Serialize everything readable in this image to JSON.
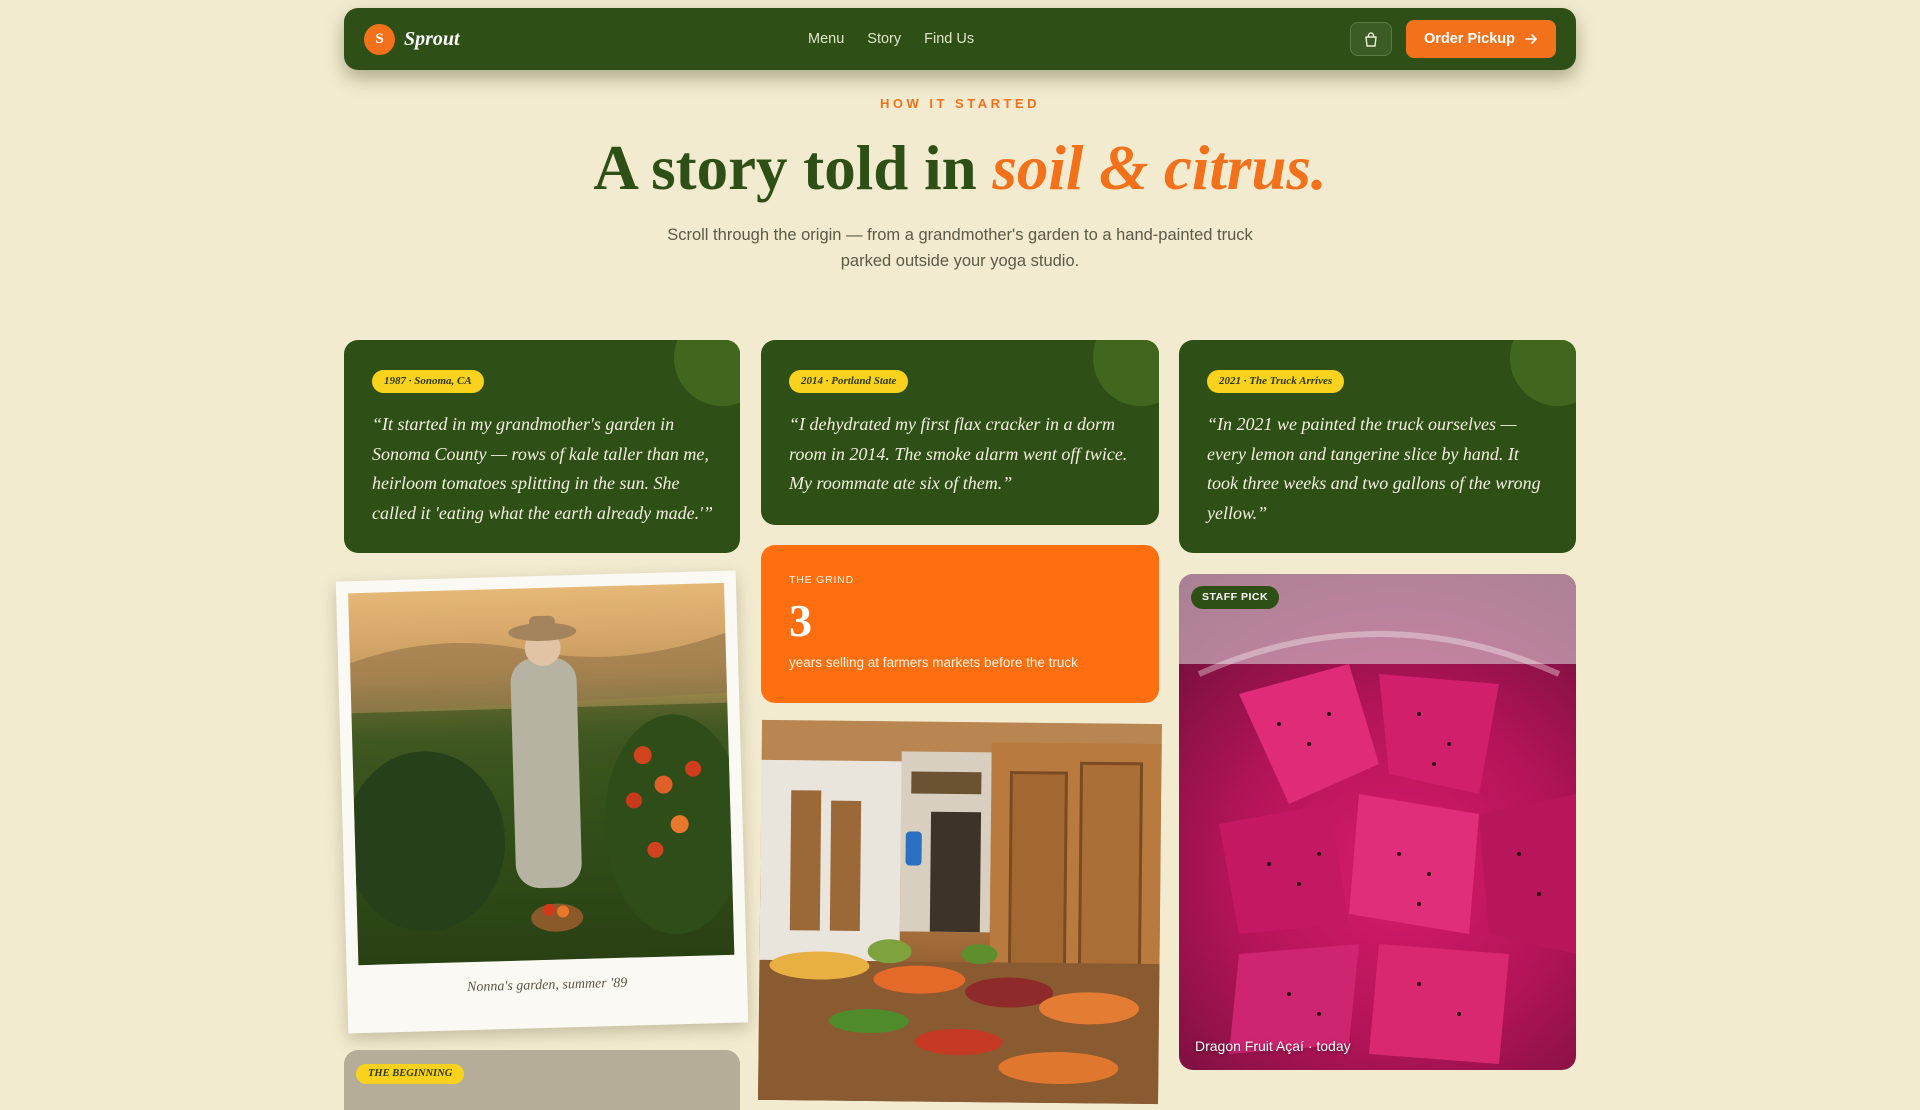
{
  "nav": {
    "logo_letter": "S",
    "brand": "Sprout",
    "links": [
      "Menu",
      "Story",
      "Find Us"
    ],
    "cart_icon": "shopping-bag-icon",
    "order_label": "Order Pickup",
    "order_icon": "arrow-right-icon"
  },
  "hero": {
    "eyebrow": "HOW IT STARTED",
    "headline_main": "A story told in ",
    "headline_accent": "soil & citrus.",
    "subtitle": "Scroll through the origin — from a grandmother's garden to a hand-painted truck parked outside your yoga studio."
  },
  "cards": [
    {
      "tag": "1987 · Sonoma, CA",
      "quote": "“It started in my grandmother's garden in Sonoma County — rows of kale taller than me, heirloom tomatoes splitting in the sun. She called it 'eating what the earth already made.'”"
    },
    {
      "tag": "2014 · Portland State",
      "quote": "“I dehydrated my first flax cracker in a dorm room in 2014. The smoke alarm went off twice. My roommate ate six of them.”"
    },
    {
      "tag": "2021 · The Truck Arrives",
      "quote": "“In 2021 we painted the truck ourselves — every lemon and tangerine slice by hand. It took three weeks and two gallons of the wrong yellow.”"
    }
  ],
  "grind": {
    "label": "THE GRIND",
    "number": "3",
    "description": "years selling at farmers markets before the truck"
  },
  "polaroid": {
    "caption": "Nonna's garden, summer '89"
  },
  "beginning": {
    "tag": "THE BEGINNING"
  },
  "dragon": {
    "badge": "STAFF PICK",
    "caption": "Dragon Fruit Açaí · today"
  },
  "colors": {
    "background": "#f3ebcf",
    "forest": "#2e5016",
    "orange": "#f4711b",
    "yellow": "#f8d21c",
    "magenta": "#b31458"
  }
}
